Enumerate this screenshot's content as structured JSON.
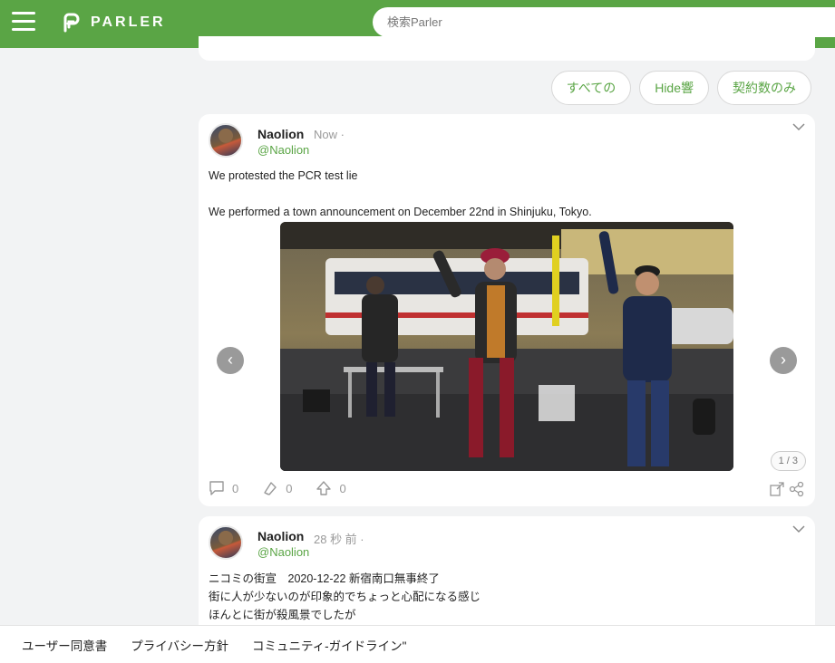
{
  "header": {
    "logo_text": "PARLER",
    "search_placeholder": "検索Parler"
  },
  "filters": [
    "すべての",
    "Hide響",
    "契約数のみ"
  ],
  "posts": [
    {
      "name": "Naolion",
      "time": "Now ·",
      "handle": "@Naolion",
      "lines": [
        "We protested the PCR test lie",
        "We performed a town announcement on December 22nd in Shinjuku, Tokyo."
      ],
      "media_counter": "1 / 3",
      "comments": "0",
      "echoes": "0",
      "upvotes": "0"
    },
    {
      "name": "Naolion",
      "time": "28 秒 前 ·",
      "handle": "@Naolion",
      "lines": [
        "ニコミの街宣　2020-12-22 新宿南口無事終了",
        "街に人が少ないのが印象的でちょっと心配になる感じ",
        "ほんとに街が殺風景でしたが"
      ]
    }
  ],
  "footer": {
    "links": [
      "ユーザー同意書",
      "プライバシー方針",
      "コミュニティ-ガイドライン\""
    ]
  }
}
